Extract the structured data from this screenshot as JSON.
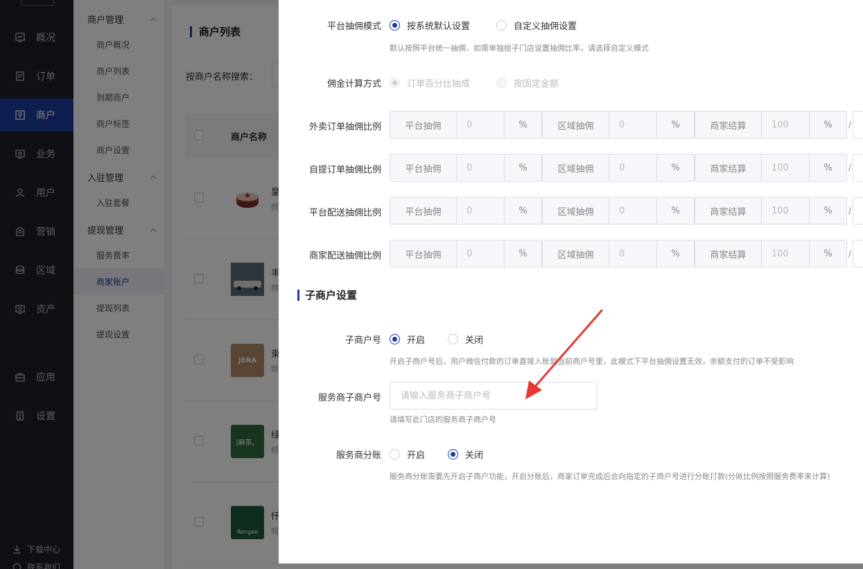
{
  "nav": {
    "items": [
      {
        "label": "概况",
        "icon": "chart-icon"
      },
      {
        "label": "订单",
        "icon": "order-icon"
      },
      {
        "label": "商户",
        "icon": "shop-icon"
      },
      {
        "label": "业务",
        "icon": "business-icon"
      },
      {
        "label": "用户",
        "icon": "user-icon"
      },
      {
        "label": "营销",
        "icon": "marketing-icon"
      },
      {
        "label": "区域",
        "icon": "region-icon"
      },
      {
        "label": "资产",
        "icon": "asset-icon"
      },
      {
        "label": "应用",
        "icon": "app-icon"
      },
      {
        "label": "设置",
        "icon": "settings-icon"
      }
    ],
    "active": "商户",
    "download": "下载中心",
    "contact": "联系我们"
  },
  "subnav": {
    "groups": [
      {
        "title": "商户管理",
        "items": [
          "商户概况",
          "商户列表",
          "到期商户",
          "商户标签",
          "商户设置"
        ]
      },
      {
        "title": "入驻管理",
        "items": [
          "入驻套餐"
        ]
      },
      {
        "title": "提现管理",
        "items": [
          "服务费率",
          "商家账户",
          "提现列表",
          "提现设置"
        ]
      }
    ],
    "active": "商家账户"
  },
  "main": {
    "title": "商户列表",
    "search_label": "按商户名称搜索：",
    "col_name": "商户名称",
    "rows": [
      {
        "name": "皇",
        "sub": "频"
      },
      {
        "name": "丰",
        "sub": "频"
      },
      {
        "name": "束",
        "sub": "频"
      },
      {
        "name": "绿",
        "sub": "频"
      },
      {
        "name": "仟",
        "sub": "频"
      }
    ],
    "thumb_texts": {
      "row3": "JERA",
      "row4": "|麻茶。",
      "row5": "Rengee"
    }
  },
  "drawer": {
    "mode_label": "平台抽佣模式",
    "mode_options": [
      "按系统默认设置",
      "自定义抽佣设置"
    ],
    "mode_hint": "默认按照平台统一抽佣，如需单独给子门店设置抽佣比率，请选择自定义模式",
    "calc_label": "佣金计算方式",
    "calc_options": [
      "订单百分比抽成",
      "按固定金额"
    ],
    "ratio_rows": [
      {
        "label": "外卖订单抽佣比例",
        "platform": "0",
        "region": "0",
        "merchant": "100"
      },
      {
        "label": "自提订单抽佣比例",
        "platform": "0",
        "region": "0",
        "merchant": "100"
      },
      {
        "label": "平台配送抽佣比例",
        "platform": "0",
        "region": "0",
        "merchant": "100"
      },
      {
        "label": "商家配送抽佣比例",
        "platform": "0",
        "region": "0",
        "merchant": "100"
      }
    ],
    "prefix_platform": "平台抽佣",
    "prefix_region": "区域抽佣",
    "prefix_merchant": "商家结算",
    "percent": "%",
    "slash": "/",
    "sub_section_title": "子商户设置",
    "sub_label": "子商户号",
    "on": "开启",
    "off": "关闭",
    "sub_hint": "开启子商户号后，用户微信付款的订单直接入账到当前商户号里，此模式下平台抽佣设置无效，余额支付的订单不受影响",
    "svc_label": "服务商子商户号",
    "svc_placeholder": "请输入服务商子商户号",
    "svc_hint": "请填写此门店的服务商子商户号",
    "split_label": "服务商分账",
    "split_hint": "服务商分账需要先开启子商户功能，开启分账后，商家订单完成后会向指定的子商户号进行分账打款(分账比例按照服务费率来计算)"
  },
  "colors": {
    "accent": "#1c3c9e",
    "arrow": "#e53935",
    "nav_bg": "#1e2028"
  }
}
